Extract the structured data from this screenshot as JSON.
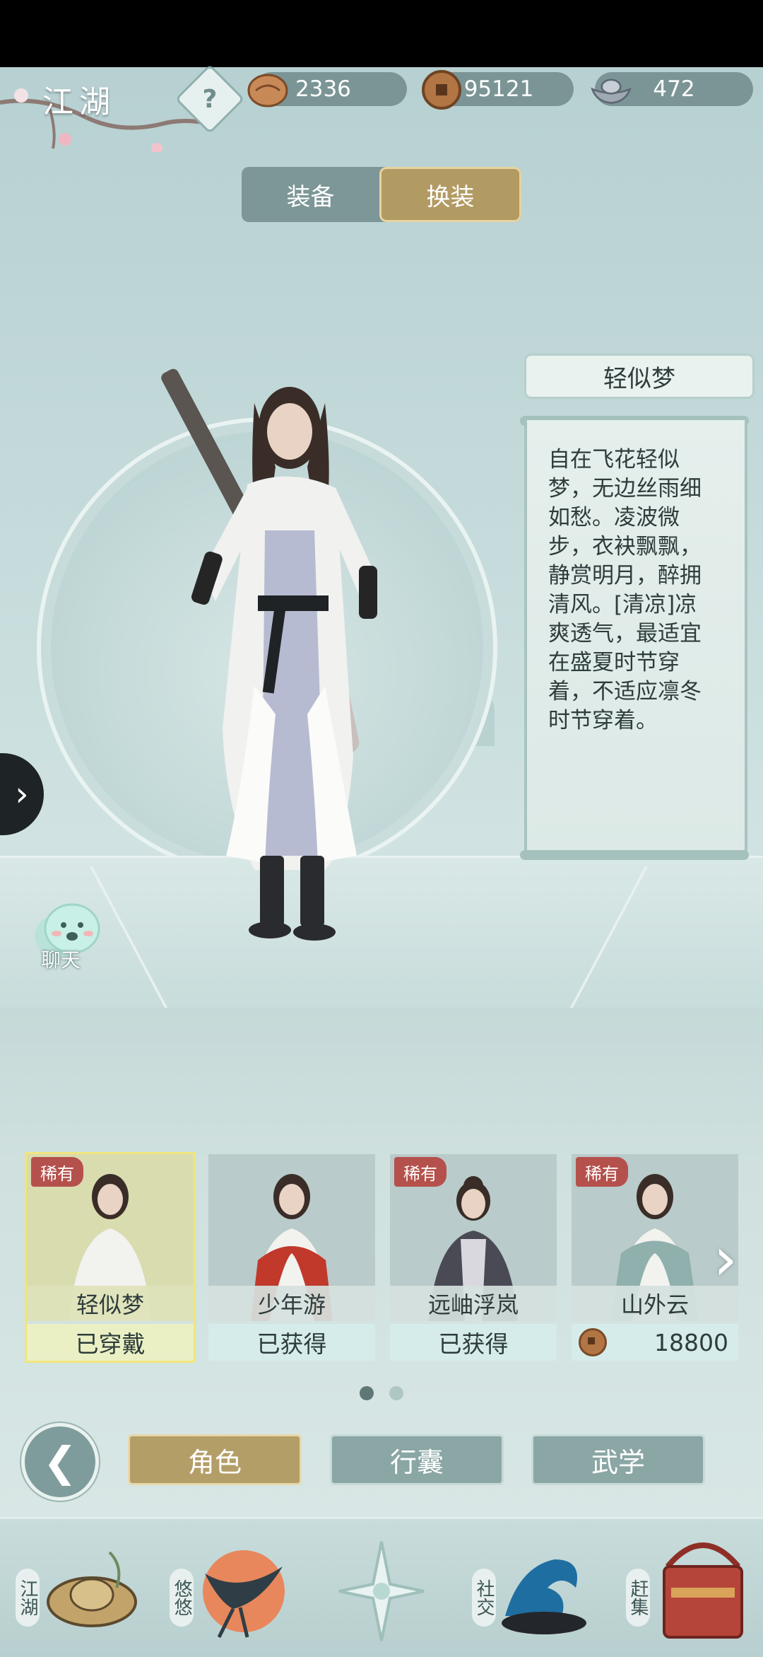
{
  "header": {
    "region_title": "江湖",
    "help_label": "?",
    "currencies": [
      {
        "name": "bun-icon",
        "value": "2336"
      },
      {
        "name": "copper-coin-icon",
        "value": "95121"
      },
      {
        "name": "silver-ingot-icon",
        "value": "472"
      }
    ]
  },
  "tabs": [
    {
      "label": "装备",
      "active": false
    },
    {
      "label": "换装",
      "active": true
    }
  ],
  "outfit": {
    "name": "轻似梦",
    "description": "自在飞花轻似梦，无边丝雨细如愁。凌波微步，衣袂飘飘，静赏明月，醉拥清风。[清凉]凉爽透气，最适宜在盛夏时节穿着，不适应凛冬时节穿着。"
  },
  "chat": {
    "label": "聊天"
  },
  "cards": [
    {
      "name": "轻似梦",
      "status": "已穿戴",
      "rare": "稀有",
      "selected": true,
      "scarf": "#f2f2ef"
    },
    {
      "name": "少年游",
      "status": "已获得",
      "rare": "",
      "selected": false,
      "scarf": "#c0392b"
    },
    {
      "name": "远岫浮岚",
      "status": "已获得",
      "rare": "稀有",
      "selected": false,
      "scarf": "#4a4a55"
    },
    {
      "name": "山外云",
      "status": "18800",
      "rare": "稀有",
      "selected": false,
      "scarf": "#8fb0ad"
    }
  ],
  "pager": {
    "total": 2,
    "current": 1
  },
  "actions": {
    "back": "❮",
    "buttons": [
      {
        "label": "角色",
        "active": true
      },
      {
        "label": "行囊",
        "active": false
      },
      {
        "label": "武学",
        "active": false
      }
    ]
  },
  "bottom_nav": [
    {
      "label": "江湖",
      "icon": "straw-hat-icon"
    },
    {
      "label": "悠悠",
      "icon": "swallow-icon"
    },
    {
      "label": "",
      "icon": "compass-star-icon"
    },
    {
      "label": "社交",
      "icon": "wave-icon"
    },
    {
      "label": "赶集",
      "icon": "basket-icon"
    }
  ],
  "colors": {
    "accent_gold": "#b29a63",
    "teal_panel": "#7d9697",
    "rare_red": "#b5514c"
  }
}
